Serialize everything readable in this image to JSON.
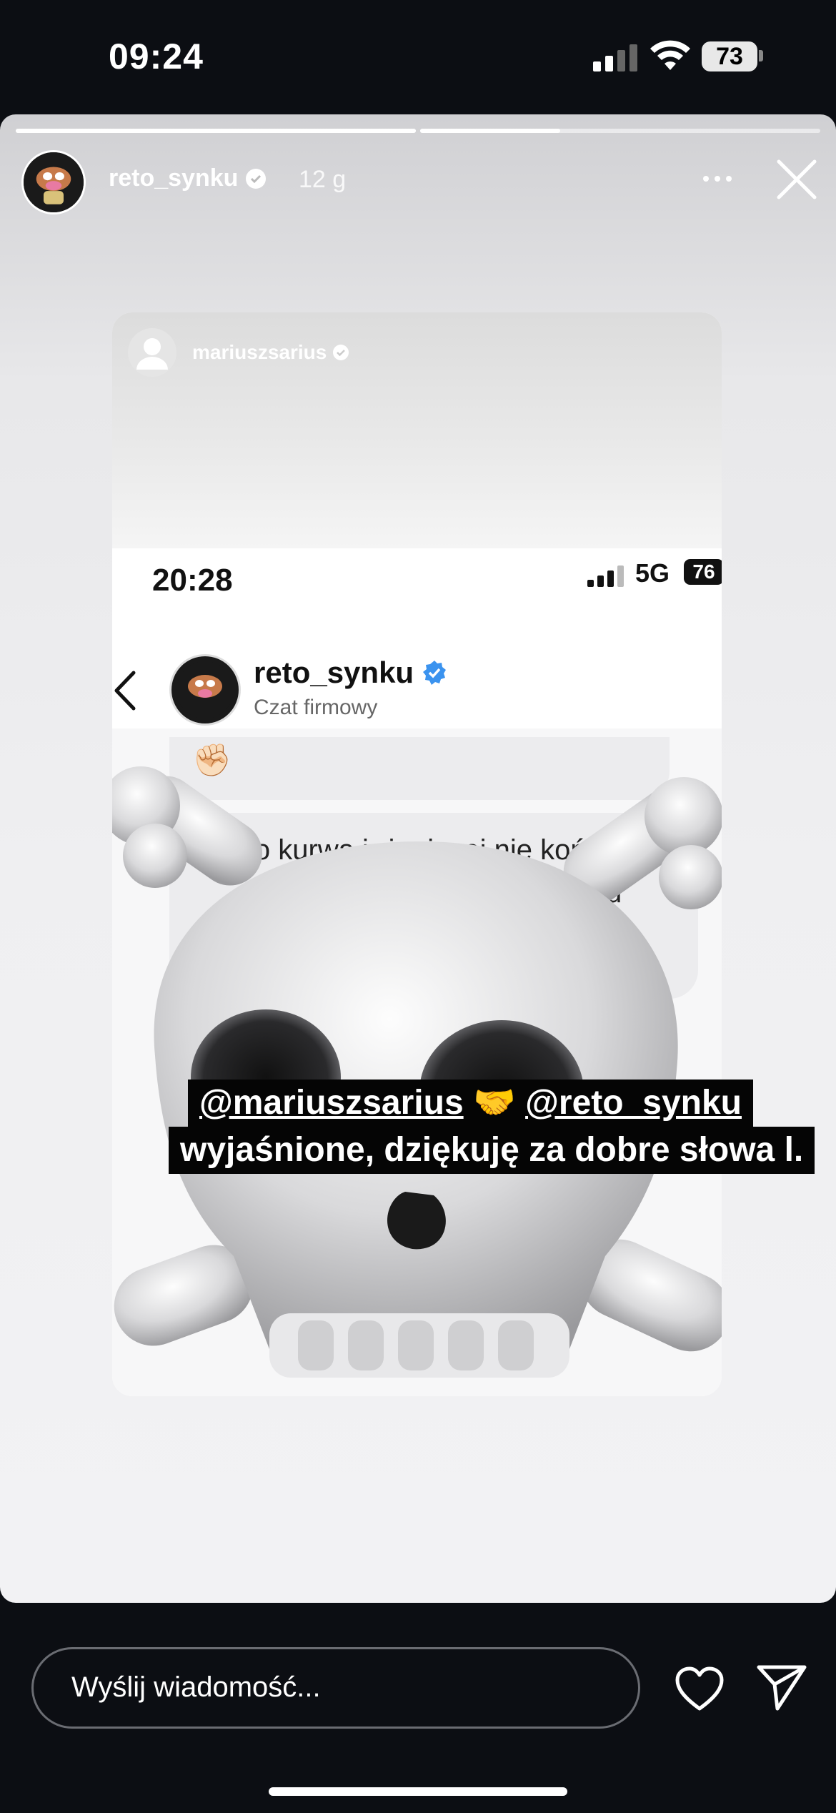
{
  "status_bar": {
    "time": "09:24",
    "battery": "73"
  },
  "story": {
    "username": "reto_synku",
    "time_ago": "12 g",
    "progress": [
      1.0,
      0.35,
      0.0
    ]
  },
  "embedded": {
    "reshared_from": "mariuszsarius",
    "status_time": "20:28",
    "network": "5G",
    "battery": "76",
    "chat_name": "reto_synku",
    "chat_subtitle": "Czat firmowy",
    "message_fragment": "lko kurwa już więcej nie koń",
    "message_fragment2": "otrzebu",
    "emoji": "✊🏻"
  },
  "caption": {
    "line1_mention1": "@mariuszsarius",
    "line1_emoji": "🤝",
    "line1_mention2": "@reto_synku",
    "line2": "wyjaśnione, dziękuję za dobre słowa l."
  },
  "reply": {
    "placeholder": "Wyślij wiadomość..."
  },
  "icons": [
    "signal-icon",
    "wifi-icon",
    "battery-icon",
    "verified-icon",
    "more-icon",
    "close-icon",
    "back-icon",
    "heart-icon",
    "send-icon"
  ]
}
